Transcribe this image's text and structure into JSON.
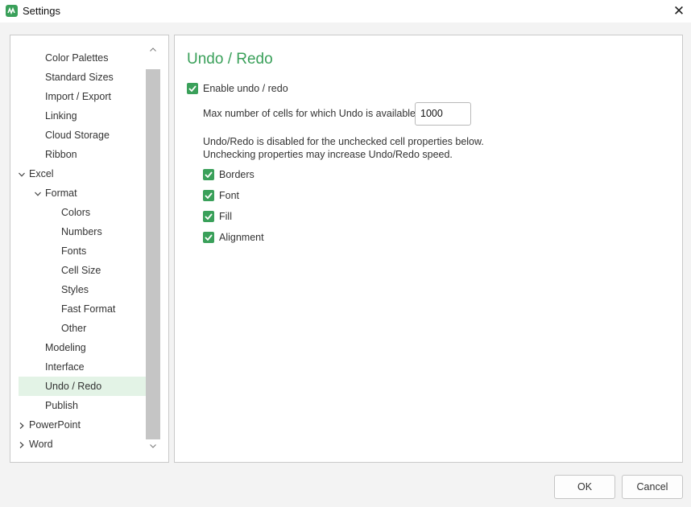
{
  "window": {
    "title": "Settings",
    "app_icon": "app-logo-icon",
    "close_symbol": "✕"
  },
  "tree": {
    "items": [
      {
        "label": "Color Palettes",
        "level": 1
      },
      {
        "label": "Standard Sizes",
        "level": 1
      },
      {
        "label": "Import / Export",
        "level": 1
      },
      {
        "label": "Linking",
        "level": 1
      },
      {
        "label": "Cloud Storage",
        "level": 1
      },
      {
        "label": "Ribbon",
        "level": 1
      },
      {
        "label": "Excel",
        "level": 0,
        "expander": "expanded"
      },
      {
        "label": "Format",
        "level": 1,
        "expander": "expanded"
      },
      {
        "label": "Colors",
        "level": 2
      },
      {
        "label": "Numbers",
        "level": 2
      },
      {
        "label": "Fonts",
        "level": 2
      },
      {
        "label": "Cell Size",
        "level": 2
      },
      {
        "label": "Styles",
        "level": 2
      },
      {
        "label": "Fast Format",
        "level": 2
      },
      {
        "label": "Other",
        "level": 2
      },
      {
        "label": "Modeling",
        "level": 1
      },
      {
        "label": "Interface",
        "level": 1
      },
      {
        "label": "Undo / Redo",
        "level": 1,
        "selected": true
      },
      {
        "label": "Publish",
        "level": 1
      },
      {
        "label": "PowerPoint",
        "level": 0,
        "expander": "collapsed"
      },
      {
        "label": "Word",
        "level": 0,
        "expander": "collapsed"
      }
    ]
  },
  "content": {
    "title": "Undo / Redo",
    "enable": {
      "label": "Enable undo / redo",
      "checked": true
    },
    "max_cells": {
      "label": "Max number of cells for which Undo is available",
      "value": "1000"
    },
    "info_line1": "Undo/Redo is disabled for the unchecked cell properties below.",
    "info_line2": "Unchecking properties may increase Undo/Redo speed.",
    "properties": [
      {
        "label": "Borders",
        "checked": true
      },
      {
        "label": "Font",
        "checked": true
      },
      {
        "label": "Fill",
        "checked": true
      },
      {
        "label": "Alignment",
        "checked": true
      }
    ]
  },
  "footer": {
    "ok_label": "OK",
    "cancel_label": "Cancel"
  },
  "colors": {
    "accent": "#3aa05a",
    "selection": "#e3f3e6"
  }
}
